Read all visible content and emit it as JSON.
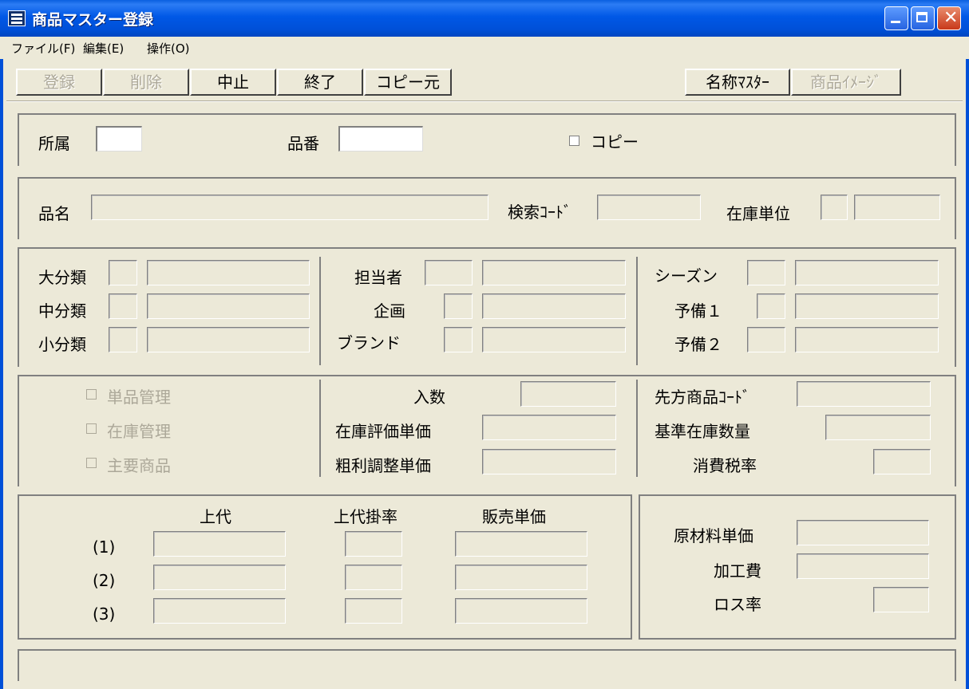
{
  "window": {
    "title": "商品マスター登録"
  },
  "menu": [
    "ファイル(F)",
    "編集(E)",
    "操作(O)"
  ],
  "toolbar": {
    "register": "登録",
    "delete": "削除",
    "cancel": "中止",
    "exit": "終了",
    "copy_source": "コピー元",
    "name_master": "名称ﾏｽﾀｰ",
    "product_image": "商品ｲﾒｰｼﾞ"
  },
  "header": {
    "affiliation": "所属",
    "item_number": "品番",
    "copy": "コピー"
  },
  "basic": {
    "product_name": "品名",
    "search_code": "検索ｺｰﾄﾞ",
    "stock_unit": "在庫単位"
  },
  "classification": {
    "large": "大分類",
    "medium": "中分類",
    "small": "小分類",
    "person": "担当者",
    "plan": "企画",
    "brand": "ブランド",
    "season": "シーズン",
    "spare1": "予備１",
    "spare2": "予備２"
  },
  "management": {
    "unit_mgmt": "単品管理",
    "stock_mgmt": "在庫管理",
    "main_product": "主要商品",
    "quantity": "入数",
    "stock_eval_price": "在庫評価単価",
    "margin_adjust_price": "粗利調整単価",
    "supplier_code": "先方商品ｺｰﾄﾞ",
    "standard_stock_qty": "基準在庫数量",
    "tax_rate": "消費税率"
  },
  "pricing": {
    "retail": "上代",
    "retail_rate": "上代掛率",
    "sales_price": "販売単価",
    "rows": [
      "(1)",
      "(2)",
      "(3)"
    ]
  },
  "cost": {
    "material_price": "原材料単価",
    "processing_fee": "加工費",
    "loss_rate": "ロス率"
  }
}
